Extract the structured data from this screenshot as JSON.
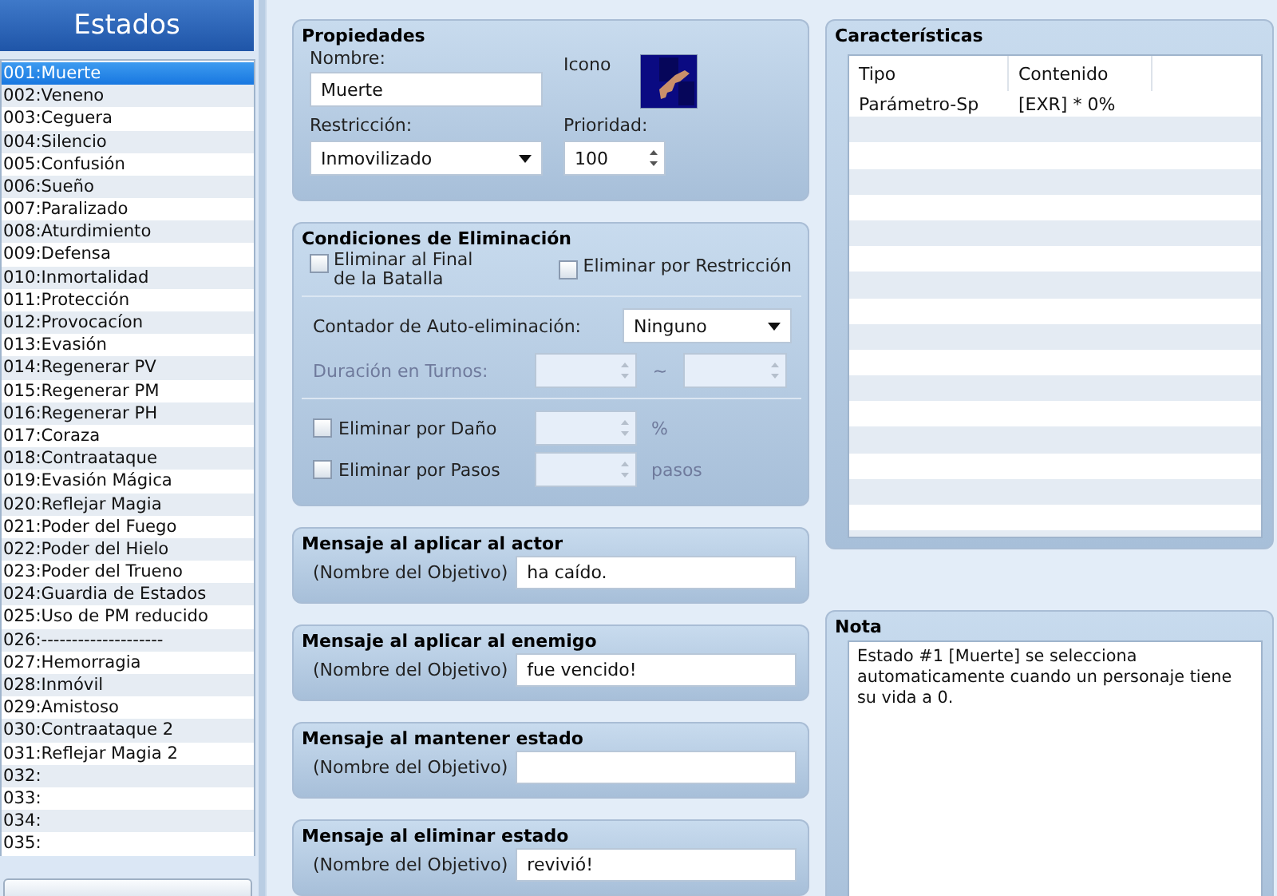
{
  "sidebar": {
    "title": "Estados",
    "items": [
      {
        "label": "001:Muerte",
        "selected": true
      },
      {
        "label": "002:Veneno",
        "selected": false
      },
      {
        "label": "003:Ceguera",
        "selected": false
      },
      {
        "label": "004:Silencio",
        "selected": false
      },
      {
        "label": "005:Confusión",
        "selected": false
      },
      {
        "label": "006:Sueño",
        "selected": false
      },
      {
        "label": "007:Paralizado",
        "selected": false
      },
      {
        "label": "008:Aturdimiento",
        "selected": false
      },
      {
        "label": "009:Defensa",
        "selected": false
      },
      {
        "label": "010:Inmortalidad",
        "selected": false
      },
      {
        "label": "011:Protección",
        "selected": false
      },
      {
        "label": "012:Provocacíon",
        "selected": false
      },
      {
        "label": "013:Evasión",
        "selected": false
      },
      {
        "label": "014:Regenerar PV",
        "selected": false
      },
      {
        "label": "015:Regenerar PM",
        "selected": false
      },
      {
        "label": "016:Regenerar PH",
        "selected": false
      },
      {
        "label": "017:Coraza",
        "selected": false
      },
      {
        "label": "018:Contraataque",
        "selected": false
      },
      {
        "label": "019:Evasión Mágica",
        "selected": false
      },
      {
        "label": "020:Reflejar Magia",
        "selected": false
      },
      {
        "label": "021:Poder del Fuego",
        "selected": false
      },
      {
        "label": "022:Poder del Hielo",
        "selected": false
      },
      {
        "label": "023:Poder del Trueno",
        "selected": false
      },
      {
        "label": "024:Guardia de Estados",
        "selected": false
      },
      {
        "label": "025:Uso de PM reducido",
        "selected": false
      },
      {
        "label": "026:--------------------",
        "selected": false
      },
      {
        "label": "027:Hemorragia",
        "selected": false
      },
      {
        "label": "028:Inmóvil",
        "selected": false
      },
      {
        "label": "029:Amistoso",
        "selected": false
      },
      {
        "label": "030:Contraataque 2",
        "selected": false
      },
      {
        "label": "031:Reflejar Magia 2",
        "selected": false
      },
      {
        "label": "032:",
        "selected": false
      },
      {
        "label": "033:",
        "selected": false
      },
      {
        "label": "034:",
        "selected": false
      },
      {
        "label": "035:",
        "selected": false
      }
    ]
  },
  "properties": {
    "title": "Propiedades",
    "name_label": "Nombre:",
    "name_value": "Muerte",
    "icon_label": "Icono",
    "restriction_label": "Restricción:",
    "restriction_value": "Inmovilizado",
    "priority_label": "Prioridad:",
    "priority_value": "100"
  },
  "removal": {
    "title": "Condiciones de Eliminación",
    "checkboxes": [
      {
        "label": "Eliminar al Final de la Batalla",
        "checked": false
      },
      {
        "label": "Eliminar por Restricción",
        "checked": false
      }
    ],
    "auto_label": "Contador de Auto-eliminación:",
    "auto_value": "Ninguno",
    "duration_label": "Duración en Turnos:",
    "duration_disabled": true,
    "duration_separator": "~",
    "conditions": [
      {
        "label": "Eliminar por Daño",
        "checked": false,
        "unit": "%"
      },
      {
        "label": "Eliminar por Pasos",
        "checked": false,
        "unit": "pasos"
      }
    ]
  },
  "messages": [
    {
      "title": "Mensaje al aplicar al actor",
      "prefix": "(Nombre del Objetivo)",
      "value": "ha caído."
    },
    {
      "title": "Mensaje al aplicar al enemigo",
      "prefix": "(Nombre del Objetivo)",
      "value": "fue vencido!"
    },
    {
      "title": "Mensaje al mantener estado",
      "prefix": "(Nombre del Objetivo)"
    },
    {
      "title": "Mensaje al eliminar estado",
      "prefix": "(Nombre del Objetivo)",
      "value": "revivió!"
    }
  ],
  "features": {
    "title": "Características",
    "columns": [
      "Tipo",
      "Contenido"
    ],
    "rows": [
      [
        "Parámetro-Sp",
        "[EXR] * 0%"
      ]
    ]
  },
  "note": {
    "title": "Nota",
    "text": "Estado #1 [Muerte] se selecciona automaticamente cuando un personaje tiene su vida a 0."
  }
}
